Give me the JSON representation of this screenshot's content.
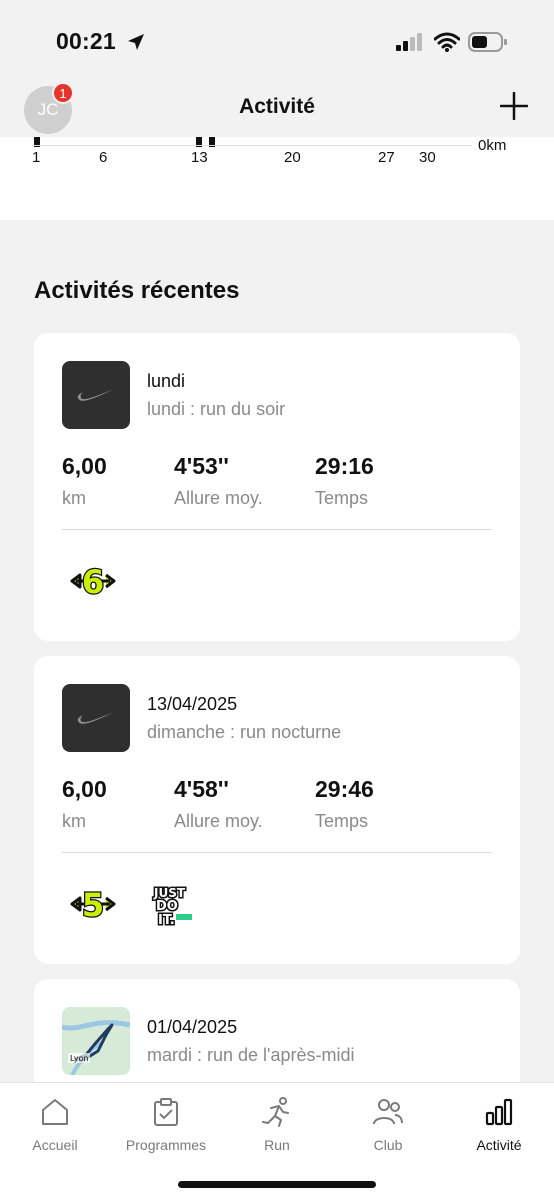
{
  "status": {
    "time": "00:21"
  },
  "header": {
    "avatar_initials": "JC",
    "notification_count": "1",
    "title": "Activité"
  },
  "calendar": {
    "ticks": [
      "1",
      "6",
      "13",
      "20",
      "27",
      "30"
    ],
    "unit": "0km"
  },
  "recent": {
    "title": "Activités récentes",
    "activities": [
      {
        "date": "lundi",
        "name": "lundi : run du soir",
        "distance": "6,00",
        "distance_unit": "km",
        "pace": "4'53''",
        "pace_label": "Allure moy.",
        "time": "29:16",
        "time_label": "Temps",
        "thumbnail": "nike-swoosh-icon",
        "badges": [
          "6k-badge-icon"
        ]
      },
      {
        "date": "13/04/2025",
        "name": "dimanche : run nocturne",
        "distance": "6,00",
        "distance_unit": "km",
        "pace": "4'58''",
        "pace_label": "Allure moy.",
        "time": "29:46",
        "time_label": "Temps",
        "thumbnail": "nike-swoosh-icon",
        "badges": [
          "5k-badge-icon",
          "just-do-it-sunday-badge-icon"
        ]
      },
      {
        "date": "01/04/2025",
        "name": "mardi : run de l'après-midi",
        "thumbnail": "route-map",
        "map_label": "Lyon"
      }
    ]
  },
  "tabs": [
    {
      "label": "Accueil",
      "icon": "home-icon"
    },
    {
      "label": "Programmes",
      "icon": "clipboard-check-icon"
    },
    {
      "label": "Run",
      "icon": "runner-icon"
    },
    {
      "label": "Club",
      "icon": "people-icon"
    },
    {
      "label": "Activité",
      "icon": "bar-chart-icon",
      "active": true
    }
  ],
  "colors": {
    "badge_red": "#e6342a",
    "badge_lime": "#c8f000",
    "text": "#111111",
    "muted": "#8a8a8a"
  }
}
